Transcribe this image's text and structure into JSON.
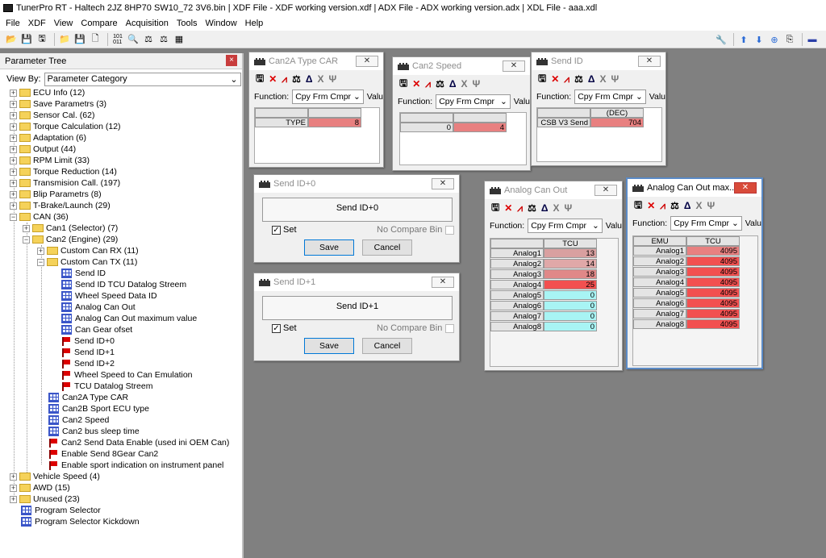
{
  "title": "TunerPro RT - Haltech 2JZ 8HP70 SW10_72 3V6.bin | XDF File - XDF working version.xdf | ADX File - ADX working version.adx | XDL File - aaa.xdl",
  "menu": [
    "File",
    "XDF",
    "View",
    "Compare",
    "Acquisition",
    "Tools",
    "Window",
    "Help"
  ],
  "panel": {
    "title": "Parameter Tree",
    "view_by_label": "View By:",
    "view_by_value": "Parameter Category",
    "close": "×"
  },
  "tree": {
    "n0": "ECU Info (12)",
    "n1": "Save Parametrs (3)",
    "n2": "Sensor Cal. (62)",
    "n3": "Torque Calculation (12)",
    "n4": "Adaptation (6)",
    "n5": "Output (44)",
    "n6": "RPM Limit (33)",
    "n7": "Torque Reduction (14)",
    "n8": "Transmision Call. (197)",
    "n9": "Blip Parametrs (8)",
    "n10": "T-Brake/Launch (29)",
    "n11": "CAN (36)",
    "n12": "Can1 (Selector) (7)",
    "n13": "Can2 (Engine) (29)",
    "n14": "Custom Can RX (11)",
    "n15": "Custom Can TX (11)",
    "n16": "Send  ID",
    "n17": "Send  ID TCU Datalog Streem",
    "n18": "Wheel Speed Data ID",
    "n19": "Analog Can Out",
    "n20": "Analog Can Out maximum value",
    "n21": "Can Gear ofset",
    "n22": "Send ID+0",
    "n23": "Send ID+1",
    "n24": "Send ID+2",
    "n25": "Wheel Speed to Can Emulation",
    "n26": "TCU Datalog Streem",
    "n27": "Can2A Type CAR",
    "n28": "Can2B Sport ECU type",
    "n29": "Can2 Speed",
    "n30": "Can2 bus sleep time",
    "n31": "Can2 Send Data Enable (used ini OEM Can)",
    "n32": "Enable Send 8Gear Can2",
    "n33": "Enable sport indication on instrument panel",
    "n34": "Vehicle Speed (4)",
    "n35": "AWD (15)",
    "n36": "Unused (23)",
    "n37": "Program Selector",
    "n38": "Program Selector Kickdown"
  },
  "common": {
    "function_label": "Function:",
    "function_value": "Cpy Frm Cmpr",
    "value_label": "Valu",
    "set_label": "Set",
    "no_compare": "No Compare Bin",
    "save": "Save",
    "cancel": "Cancel"
  },
  "win_can2a": {
    "title": "Can2A Type CAR",
    "row": "TYPE",
    "value": "8"
  },
  "win_can2speed": {
    "title": "Can2 Speed",
    "row": "0",
    "value": "4"
  },
  "win_sendid": {
    "title": "Send  ID",
    "col": "(DEC)",
    "row": "CSB V3 Send",
    "value": "704"
  },
  "win_sendid0": {
    "title": "Send ID+0",
    "label": "Send ID+0"
  },
  "win_sendid1": {
    "title": "Send ID+1",
    "label": "Send ID+1"
  },
  "win_analog": {
    "title": "Analog Can Out",
    "col": "TCU",
    "rows": [
      "Analog1",
      "Analog2",
      "Analog3",
      "Analog4",
      "Analog5",
      "Analog6",
      "Analog7",
      "Analog8"
    ],
    "values": [
      "13",
      "14",
      "18",
      "25",
      "0",
      "0",
      "0",
      "0"
    ]
  },
  "win_analogmax": {
    "title": "Analog Can Out max...",
    "col0": "EMU",
    "col": "TCU",
    "rows": [
      "Analog1",
      "Analog2",
      "Analog3",
      "Analog4",
      "Analog5",
      "Analog6",
      "Analog7",
      "Analog8"
    ],
    "values": [
      "4095",
      "4095",
      "4095",
      "4095",
      "4095",
      "4095",
      "4095",
      "4095"
    ]
  },
  "colors": {
    "red": "#e88080",
    "red_strong": "#f25050",
    "cyan": "#a8f4f4",
    "accent": "#0078d7"
  }
}
